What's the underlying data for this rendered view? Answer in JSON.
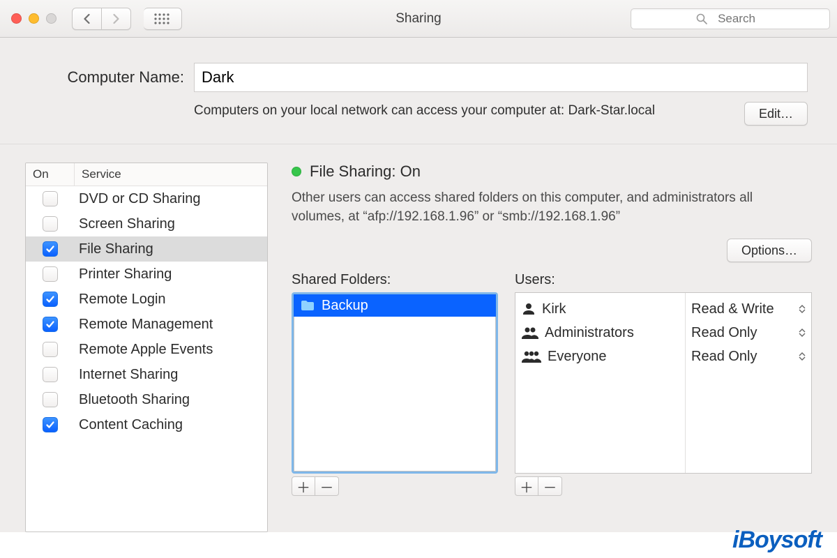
{
  "window": {
    "title": "Sharing"
  },
  "search": {
    "placeholder": "Search"
  },
  "computerName": {
    "label": "Computer Name:",
    "value": "Dark",
    "subtext": "Computers on your local network can access your computer at: Dark-Star.local",
    "editButton": "Edit…"
  },
  "services": {
    "header": {
      "on": "On",
      "service": "Service"
    },
    "items": [
      {
        "label": "DVD or CD Sharing",
        "checked": false,
        "selected": false
      },
      {
        "label": "Screen Sharing",
        "checked": false,
        "selected": false
      },
      {
        "label": "File Sharing",
        "checked": true,
        "selected": true
      },
      {
        "label": "Printer Sharing",
        "checked": false,
        "selected": false
      },
      {
        "label": "Remote Login",
        "checked": true,
        "selected": false
      },
      {
        "label": "Remote Management",
        "checked": true,
        "selected": false
      },
      {
        "label": "Remote Apple Events",
        "checked": false,
        "selected": false
      },
      {
        "label": "Internet Sharing",
        "checked": false,
        "selected": false
      },
      {
        "label": "Bluetooth Sharing",
        "checked": false,
        "selected": false
      },
      {
        "label": "Content Caching",
        "checked": true,
        "selected": false
      }
    ]
  },
  "fileSharing": {
    "statusTitle": "File Sharing: On",
    "statusColor": "#37c64b",
    "description": "Other users can access shared folders on this computer, and administrators all volumes, at “afp://192.168.1.96” or “smb://192.168.1.96”",
    "optionsButton": "Options…",
    "sharedFoldersLabel": "Shared Folders:",
    "usersLabel": "Users:",
    "folders": [
      {
        "name": "Backup",
        "selected": true
      }
    ],
    "users": [
      {
        "name": "Kirk",
        "icon": "person",
        "permission": "Read & Write"
      },
      {
        "name": "Administrators",
        "icon": "group2",
        "permission": "Read Only"
      },
      {
        "name": "Everyone",
        "icon": "group3",
        "permission": "Read Only"
      }
    ]
  },
  "watermark": "iBoysoft"
}
